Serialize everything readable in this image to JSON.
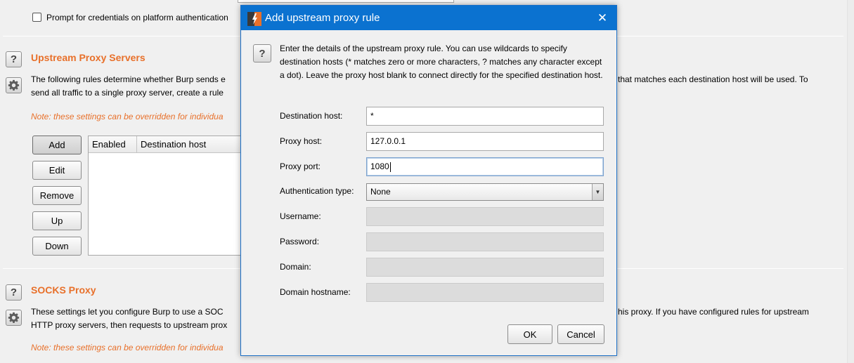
{
  "background": {
    "prompt_credentials_label": "Prompt for credentials on platform authentication",
    "upstream": {
      "title": "Upstream Proxy Servers",
      "desc_line1_left": "The following rules determine whether Burp sends e",
      "desc_line1_right": "that matches each destination host will be used. To",
      "desc_line2_left": "send all traffic to a single proxy server, create a rule",
      "note": "Note: these settings can be overridden for individua",
      "buttons": [
        "Add",
        "Edit",
        "Remove",
        "Up",
        "Down"
      ],
      "columns": [
        "Enabled",
        "Destination host"
      ]
    },
    "socks": {
      "title": "SOCKS Proxy",
      "desc_line1_left": "These settings let you configure Burp to use a SOC",
      "desc_line1_right": "his proxy. If you have configured rules for upstream",
      "desc_line2_left": "HTTP proxy servers, then requests to upstream prox",
      "note": "Note: these settings can be overridden for individua"
    },
    "accent_color": "#e8702a"
  },
  "dialog": {
    "title": "Add upstream proxy rule",
    "intro": "Enter the details of the upstream proxy rule. You can use wildcards to specify destination hosts (* matches zero or more characters, ? matches any character except a dot). Leave the proxy host blank to connect directly for the specified destination host.",
    "fields": {
      "destination_host": {
        "label": "Destination host:",
        "value": "*"
      },
      "proxy_host": {
        "label": "Proxy host:",
        "value": "127.0.0.1"
      },
      "proxy_port": {
        "label": "Proxy port:",
        "value": "1080"
      },
      "auth_type": {
        "label": "Authentication type:",
        "value": "None"
      },
      "username": {
        "label": "Username:",
        "value": ""
      },
      "password": {
        "label": "Password:",
        "value": ""
      },
      "domain": {
        "label": "Domain:",
        "value": ""
      },
      "domain_hostname": {
        "label": "Domain hostname:",
        "value": ""
      }
    },
    "ok_label": "OK",
    "cancel_label": "Cancel",
    "titlebar_color": "#0b72d0"
  }
}
